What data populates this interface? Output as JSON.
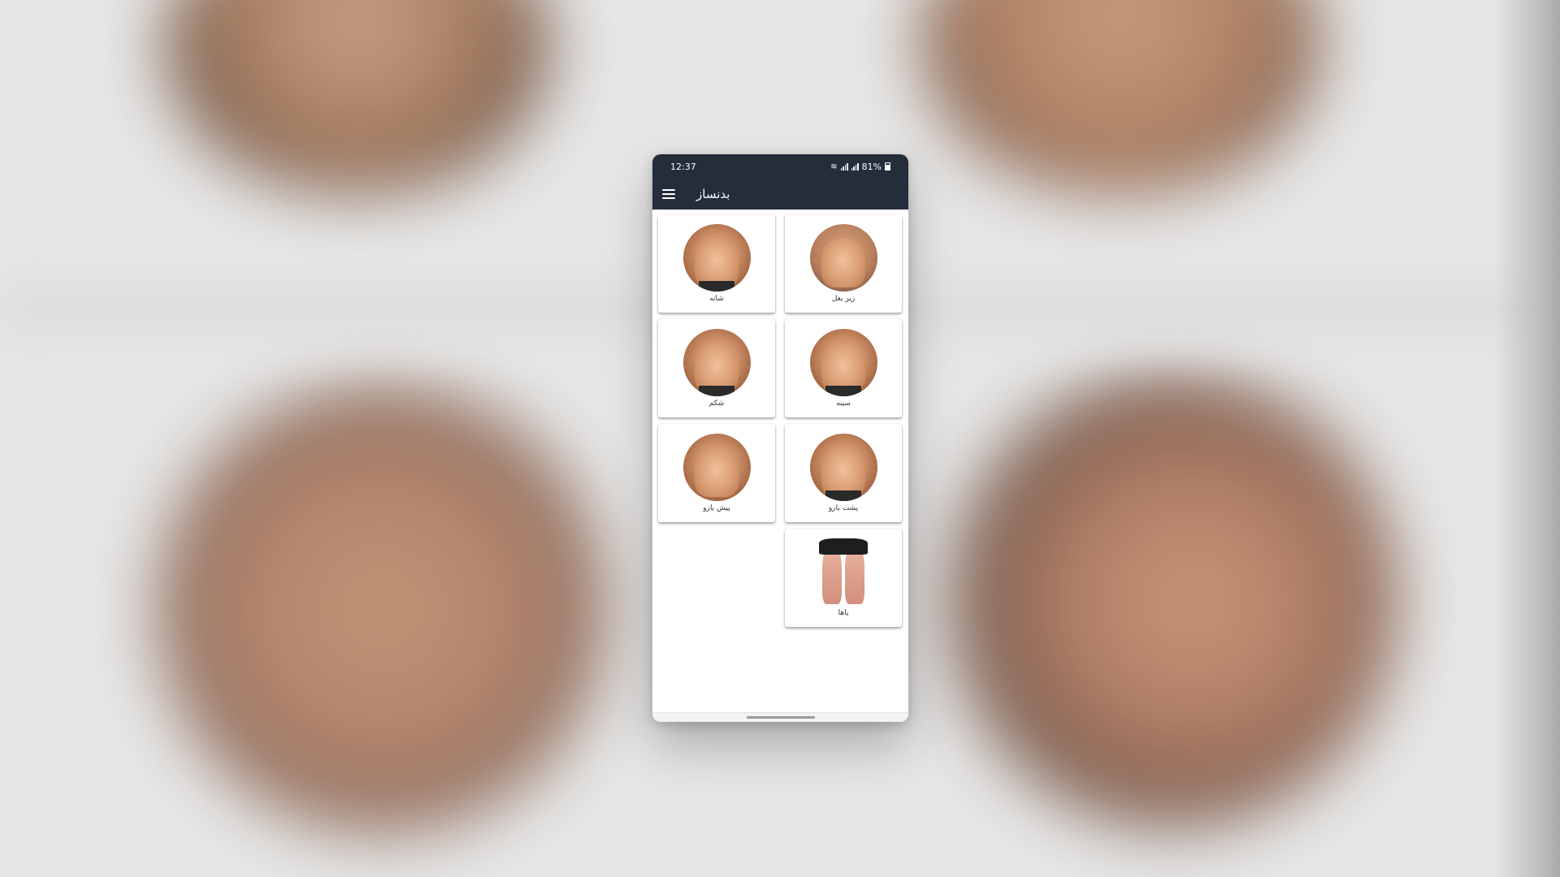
{
  "statusbar": {
    "time": "12:37",
    "battery": "81%"
  },
  "toolbar": {
    "title": "بدنساز"
  },
  "cards": [
    {
      "label": "زیر بغل",
      "image": "back-muscles"
    },
    {
      "label": "شانه",
      "image": "shoulders"
    },
    {
      "label": "سینه",
      "image": "chest"
    },
    {
      "label": "شکم",
      "image": "abs"
    },
    {
      "label": "پشت بازو",
      "image": "triceps"
    },
    {
      "label": "پیش بازو",
      "image": "biceps"
    },
    {
      "label": "پاها",
      "image": "legs"
    }
  ]
}
